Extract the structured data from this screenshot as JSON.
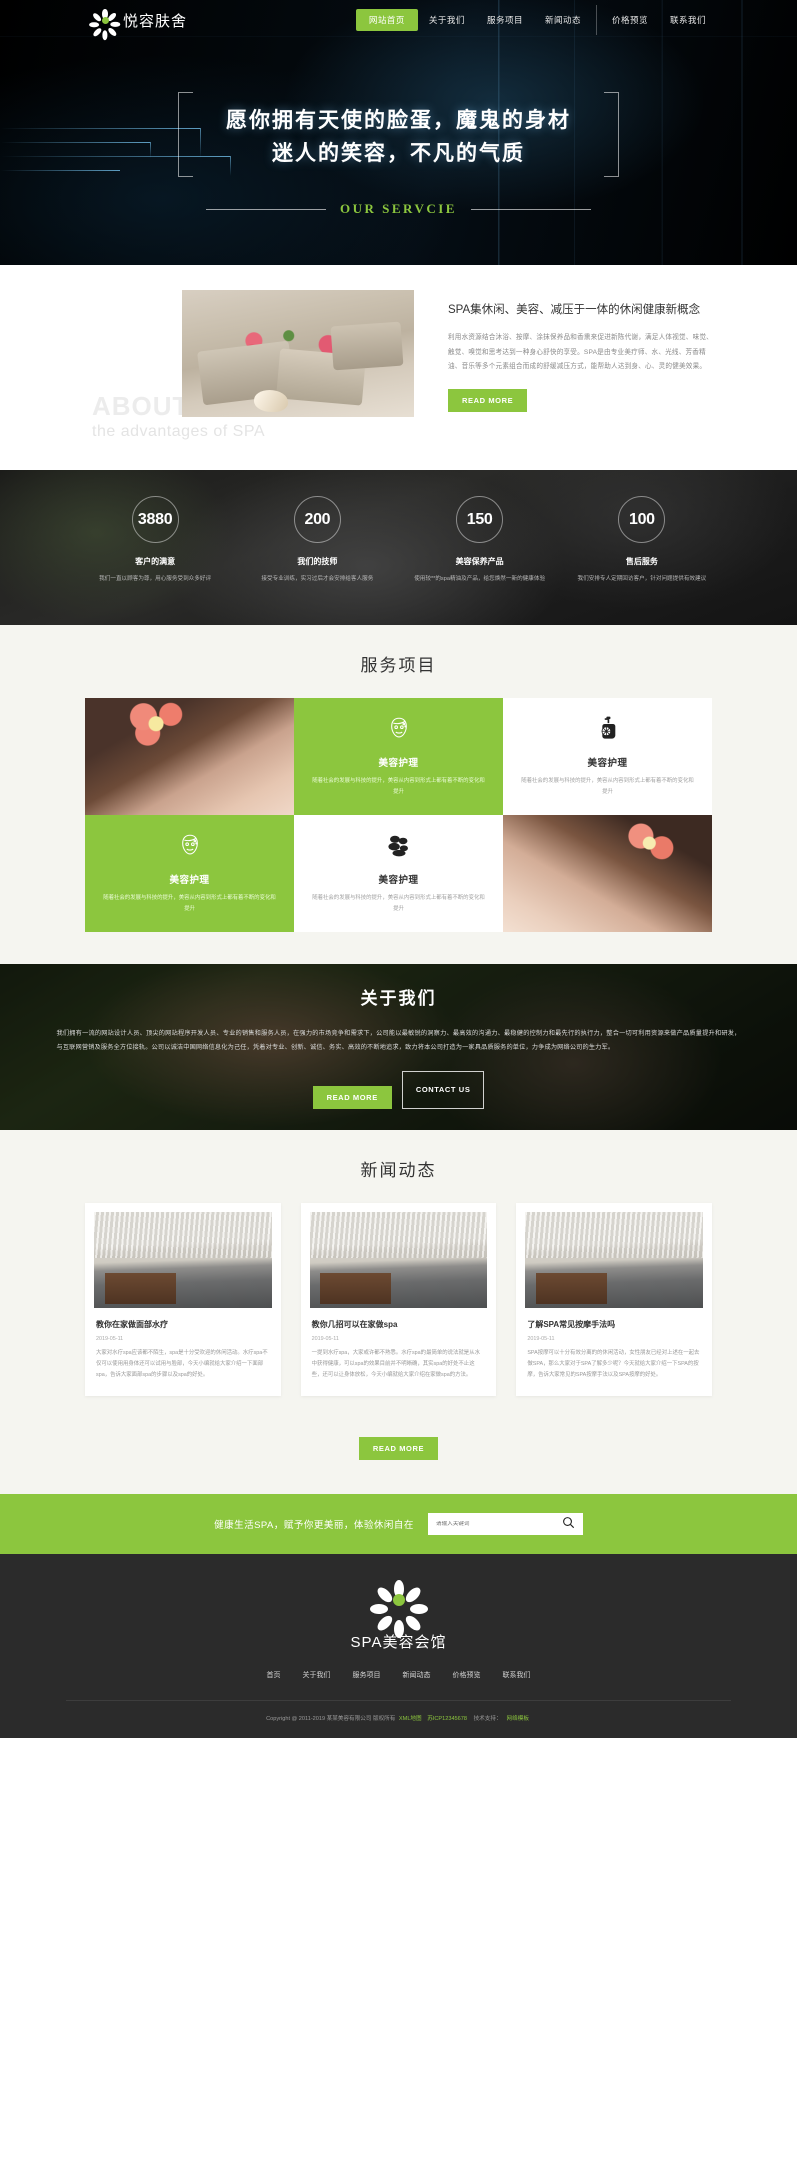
{
  "header": {
    "brand_name": "悦容肤舍",
    "logo_icon": "flower-icon",
    "nav": [
      {
        "label": "网站首页",
        "active": true
      },
      {
        "label": "关于我们",
        "active": false
      },
      {
        "label": "服务项目",
        "active": false
      },
      {
        "label": "新闻动态",
        "active": false
      },
      {
        "label": "价格预览",
        "active": false
      },
      {
        "label": "联系我们",
        "active": false
      }
    ]
  },
  "hero": {
    "line1": "愿你拥有天使的脸蛋，魔鬼的身材",
    "line2": "迷人的笑容，不凡的气质",
    "subtitle": "OUR SERVCIE"
  },
  "about": {
    "watermark_big": "ABOUT",
    "watermark_small": "the advantages of SPA",
    "title": "SPA集休闲、美容、减压于一体的休闲健康新概念",
    "body": "利用水资源结合沐浴、按摩、涂抹保养品和香熏来促进新陈代谢，满足人体视觉、味觉、触觉、嗅觉和思考达到一种身心舒快的享受。SPA是由专业美疗师、水、光线、芳香精油、音乐等多个元素组合而成的舒缓减压方式，能帮助人达到身、心、灵的健美效果。",
    "button": "READ MORE",
    "photo_alt": "spa-towels-flowers-photo"
  },
  "stats": [
    {
      "value": "3880",
      "label": "客户的满意",
      "desc": "我们一直以顾客为尊，用心服务受到众多好评"
    },
    {
      "value": "200",
      "label": "我们的技师",
      "desc": "接受专业训练，实习过后才会安排给客人服务"
    },
    {
      "value": "150",
      "label": "美容保养产品",
      "desc": "使用较**的spa精油及产品，给您焕然一新的健康体验"
    },
    {
      "value": "100",
      "label": "售后服务",
      "desc": "我们安排专人定期回访客户，针对问题提供有效建议"
    }
  ],
  "services": {
    "title": "服务项目",
    "cards": [
      {
        "kind": "photo",
        "photo": "photo-a",
        "name": "",
        "desc": "",
        "icon": ""
      },
      {
        "kind": "green",
        "photo": "",
        "name": "美容护理",
        "desc": "随着社会的发展与科技的提升，美容从内容到形式上都有着不断的变化和提升",
        "icon": "facial-mask-icon"
      },
      {
        "kind": "white",
        "photo": "",
        "name": "美容护理",
        "desc": "随着社会的发展与科技的提升，美容从内容到形式上都有着不断的变化和提升",
        "icon": "lotion-pump-icon"
      },
      {
        "kind": "green",
        "photo": "",
        "name": "美容护理",
        "desc": "随着社会的发展与科技的提升，美容从内容到形式上都有着不断的变化和提升",
        "icon": "facial-mask-icon"
      },
      {
        "kind": "white",
        "photo": "",
        "name": "美容护理",
        "desc": "随着社会的发展与科技的提升，美容从内容到形式上都有着不断的变化和提升",
        "icon": "massage-stones-icon"
      },
      {
        "kind": "photo",
        "photo": "photo-b",
        "name": "",
        "desc": "",
        "icon": ""
      }
    ]
  },
  "aboutus": {
    "title": "关于我们",
    "body": "我们拥有一流的网站设计人员、顶尖的网站程序开发人员、专业的销售和服务人员，在强力的市场竞争和需求下，公司能以最敏锐的洞察力、最高效的沟通力、最稳健的控制力和最先行的执行力，整合一切可利用资源来做产品质量提升和研发，与互联网营销及服务全方位接轨。公司以诚洁中国网络信息化为己任，凭着对专业、创新、诚信、务实、高效的不断地追求，致力将本公司打造为一家具品质服务的单位，力争成为网络公司的生力军。",
    "buttons": [
      "READ MORE",
      "CONTACT US"
    ]
  },
  "news": {
    "title": "新闻动态",
    "items": [
      {
        "title": "教你在家做面部水疗",
        "date": "2019-05-11",
        "desc": "大家对水疗spa应该都不陌生，spa是十分受欢迎的休闲活动。水疗spa不仅可以使用用身体还可以试用与脸部，今天小编就给大家介绍一下面部spa，告诉大家面部spa的步骤以及spa的好处。"
      },
      {
        "title": "教你几招可以在家做spa",
        "date": "2019-05-11",
        "desc": "一提到水疗spa，大家或许都不熟悉。水疗spa的最简单的说法就是从水中获得健康，可以spa的效果目前并不明晰确，其实spa的好处不止这些，还可以让身体放松，今天小编就给大家介绍在家做spa的方法。"
      },
      {
        "title": "了解SPA常见按摩手法吗",
        "date": "2019-05-11",
        "desc": "SPA按摩可以十分有效分离的的休闲活动，女性朋友已经对上述在一起去做SPA，那么大家对于SPA了解多少呢？今天就给大家介绍一下SPA的按摩，告诉大家常见的SPA按摩手法以及SPA按摩的好处。"
      }
    ],
    "button": "READ MORE"
  },
  "searchbar": {
    "slogan": "健康生活SPA，赋予你更美丽，体验休闲自在",
    "placeholder": "请输入关键词",
    "value": "",
    "icon": "search-icon"
  },
  "footer": {
    "logo_icon": "flower-icon",
    "brand": "SPA美容会馆",
    "nav": [
      "首页",
      "关于我们",
      "服务项目",
      "新闻动态",
      "价格预览",
      "联系我们"
    ],
    "copyright_prefix": "Copyright @ 2011-2019 某某美容有限公司 版权所有",
    "link_xml": "XML地图",
    "link_icp": "苏ICP12345678",
    "support_label": "技术支持：",
    "link_support": "网络模板"
  },
  "colors": {
    "accent": "#8cc63e",
    "dark": "#2b2b2b",
    "light_bg": "#f5f5f0"
  }
}
